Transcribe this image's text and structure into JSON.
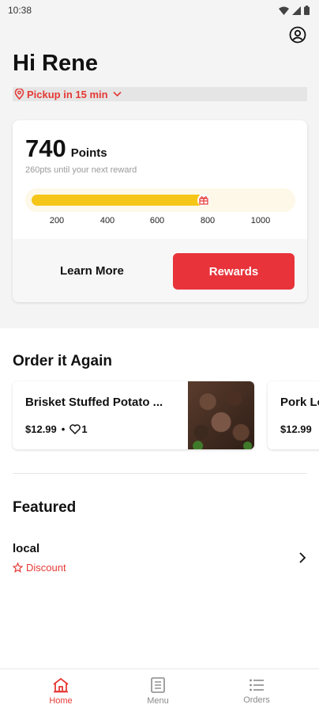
{
  "status_bar": {
    "time": "10:38"
  },
  "header": {
    "greeting": "Hi Rene",
    "pickup": "Pickup in 15 min"
  },
  "rewards_card": {
    "points": "740",
    "points_label": "Points",
    "subtext": "260pts until your next reward",
    "progress_fraction": 0.67,
    "ticks": [
      "200",
      "400",
      "600",
      "800",
      "1000"
    ],
    "learn_more": "Learn More",
    "rewards_button": "Rewards"
  },
  "order_again": {
    "title": "Order it Again",
    "items": [
      {
        "name": "Brisket Stuffed Potato ...",
        "price": "$12.99",
        "likes": "1"
      },
      {
        "name": "Pork Lo",
        "price": "$12.99"
      }
    ]
  },
  "featured": {
    "title": "Featured",
    "items": [
      {
        "name": "local",
        "tag": "Discount"
      }
    ]
  },
  "bottom_nav": {
    "items": [
      {
        "label": "Home",
        "icon": "home-icon",
        "active": true
      },
      {
        "label": "Menu",
        "icon": "menu-book-icon",
        "active": false
      },
      {
        "label": "Orders",
        "icon": "list-icon",
        "active": false
      }
    ]
  },
  "colors": {
    "accent": "#e8333a",
    "progress": "#f5c518",
    "progress_track": "#fdf8e7"
  }
}
